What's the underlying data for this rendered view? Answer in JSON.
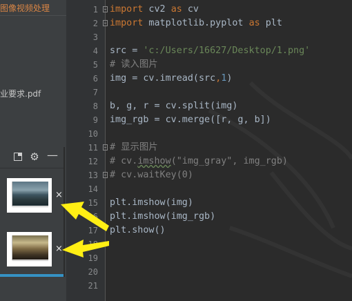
{
  "project": {
    "folder_label": "图像视频处理",
    "file_label": "作业要求.pdf"
  },
  "plots_panel": {
    "close_glyph": "×",
    "thumbnails": [
      "plot-thumbnail-1",
      "plot-thumbnail-2"
    ],
    "icons": [
      "layout-icon",
      "gear-icon",
      "minimize-icon"
    ]
  },
  "gutter": {
    "line_numbers": [
      "1",
      "2",
      "3",
      "4",
      "5",
      "6",
      "7",
      "8",
      "9",
      "10",
      "11",
      "12",
      "13",
      "14",
      "15",
      "16",
      "17",
      "18",
      "19",
      "20",
      "21"
    ]
  },
  "code": {
    "lines": [
      [
        {
          "t": "kw",
          "v": "import"
        },
        {
          "t": "id",
          "v": " cv2 "
        },
        {
          "t": "kw",
          "v": "as"
        },
        {
          "t": "id",
          "v": " cv"
        }
      ],
      [
        {
          "t": "kw",
          "v": "import"
        },
        {
          "t": "id",
          "v": " matplotlib.pyplot "
        },
        {
          "t": "kw",
          "v": "as"
        },
        {
          "t": "id",
          "v": " plt"
        }
      ],
      [],
      [
        {
          "t": "id",
          "v": "src = "
        },
        {
          "t": "str",
          "v": "'c:/Users/16627/Desktop/1.png'"
        }
      ],
      [
        {
          "t": "cm",
          "v": "# 读入图片"
        }
      ],
      [
        {
          "t": "id",
          "v": "img = cv.imread(src"
        },
        {
          "t": "kw",
          "v": ","
        },
        {
          "t": "num",
          "v": "1"
        },
        {
          "t": "id",
          "v": ")"
        }
      ],
      [],
      [
        {
          "t": "id",
          "v": "b, g, r = cv.split(img)"
        }
      ],
      [
        {
          "t": "id",
          "v": "img_rgb = cv.merge([r, g, b])"
        }
      ],
      [],
      [
        {
          "t": "cm",
          "v": "# 显示图片"
        }
      ],
      [
        {
          "t": "cm",
          "v": "# cv."
        },
        {
          "t": "cmu",
          "v": "imshow"
        },
        {
          "t": "cm",
          "v": "(\"img_gray\", img_rgb)"
        }
      ],
      [
        {
          "t": "cm",
          "v": "# cv.waitKey(0)"
        }
      ],
      [],
      [
        {
          "t": "id",
          "v": "plt.imshow(img)"
        }
      ],
      [
        {
          "t": "id",
          "v": "plt.imshow(img_rgb)"
        }
      ],
      [
        {
          "t": "id",
          "v": "plt.show()"
        }
      ],
      [],
      [],
      [],
      []
    ]
  },
  "colors": {
    "keyword": "#cc7832",
    "string": "#6a8759",
    "comment": "#808080",
    "number": "#6897bb",
    "text": "#a9b7c6",
    "annotation_arrow": "#ffef14",
    "accent_bar": "#3592c4"
  }
}
